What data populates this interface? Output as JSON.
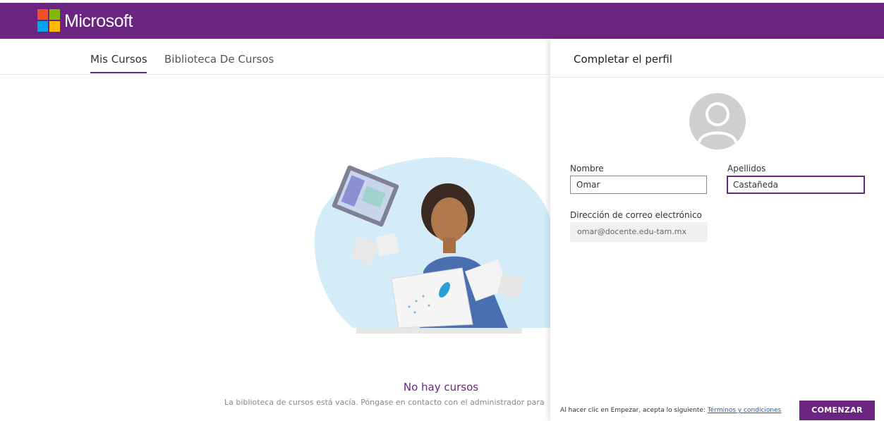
{
  "header": {
    "brand": "Microsoft",
    "brand_color": "#6b247f"
  },
  "tabs": [
    {
      "label": "Mis Cursos",
      "active": true
    },
    {
      "label": "Biblioteca De Cursos",
      "active": false
    }
  ],
  "empty_state": {
    "title": "No hay cursos",
    "description": "La biblioteca de cursos está vacía. Póngase en contacto con el administrador para"
  },
  "profile_panel": {
    "title": "Completar el perfil",
    "avatar_icon": "user-avatar-icon",
    "first_name": {
      "label": "Nombre",
      "value": "Omar"
    },
    "last_name": {
      "label": "Apellidos",
      "value": "Castañeda"
    },
    "email": {
      "label": "Dirección de correo electrónico",
      "value": "omar@docente.edu-tam.mx"
    },
    "terms_prefix": "Al hacer clic en Empezar, acepta lo siguiente:",
    "terms_link": "Términos y condiciones",
    "start_button": "COMENZAR"
  }
}
